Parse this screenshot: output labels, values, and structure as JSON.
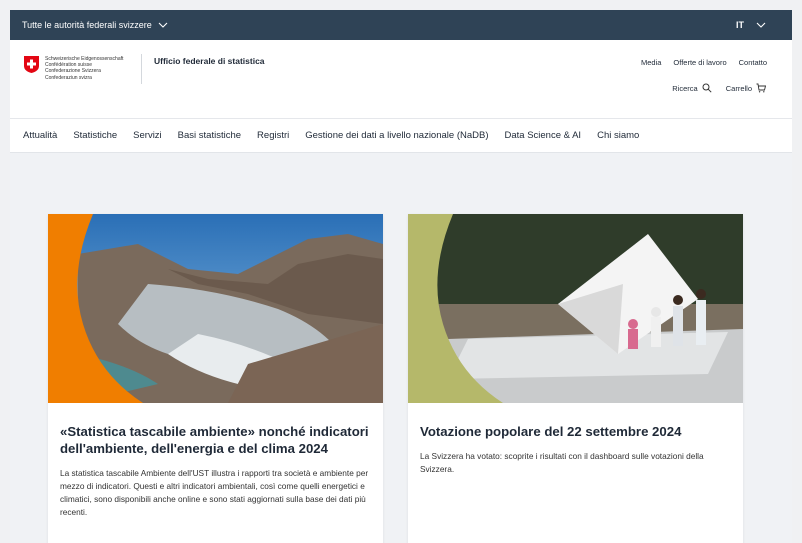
{
  "topbar": {
    "authorities": "Tutte le autorità federali svizzere",
    "language": "IT"
  },
  "header": {
    "logo_lines": [
      "Schweizerische Eidgenossenschaft",
      "Confédération suisse",
      "Confederazione Svizzera",
      "Confederaziun svizra"
    ],
    "office": "Ufficio federale di statistica",
    "links": [
      "Media",
      "Offerte di lavoro",
      "Contatto"
    ],
    "search": "Ricerca",
    "cart": "Carrello"
  },
  "nav": {
    "items": [
      "Attualità",
      "Statistiche",
      "Servizi",
      "Basi statistiche",
      "Registri",
      "Gestione dei dati a livello nazionale (NaDB)",
      "Data Science & AI",
      "Chi siamo"
    ]
  },
  "cards": [
    {
      "title": "«Statistica tascabile ambiente» nonché indicatori dell'ambiente, dell'energia e del clima 2024",
      "text": "La statistica tascabile Ambiente dell'UST illustra i rapporti tra società e ambiente per mezzo di indicatori. Questi e altri indicatori ambientali, così come quelli energetici e climatici, sono disponibili anche online e sono stati aggiornati sulla base dei dati più recenti.",
      "accent": "#f07e00"
    },
    {
      "title": "Votazione popolare del 22 settembre 2024",
      "text": "La Svizzera ha votato: scoprite i risultati con il dashboard sulle votazioni della Svizzera.",
      "accent": "#b5b86a"
    }
  ]
}
